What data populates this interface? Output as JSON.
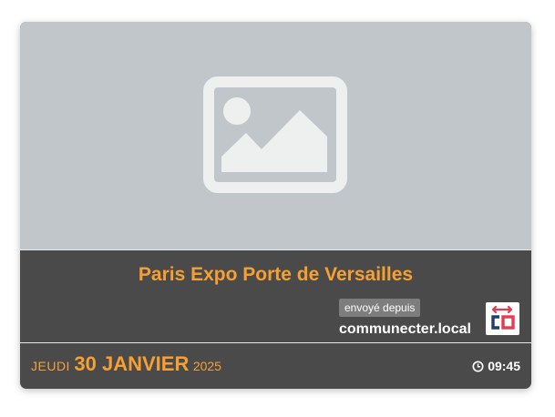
{
  "event": {
    "title": "Paris Expo Porte de Versailles",
    "source_badge": "envoyé depuis",
    "source_name": "communecter.local",
    "date": {
      "weekday": "JEUDI",
      "day_month": "30 JANVIER",
      "year": "2025"
    },
    "time": "09:45"
  },
  "icons": {
    "image_placeholder": "image-placeholder-icon",
    "clock": "clock-icon",
    "logo": "communecter-logo"
  },
  "colors": {
    "accent": "#f6a033",
    "card_bg": "#4a4a4a",
    "media_bg": "#c1c6ca",
    "badge_bg": "#7d7d7d"
  }
}
